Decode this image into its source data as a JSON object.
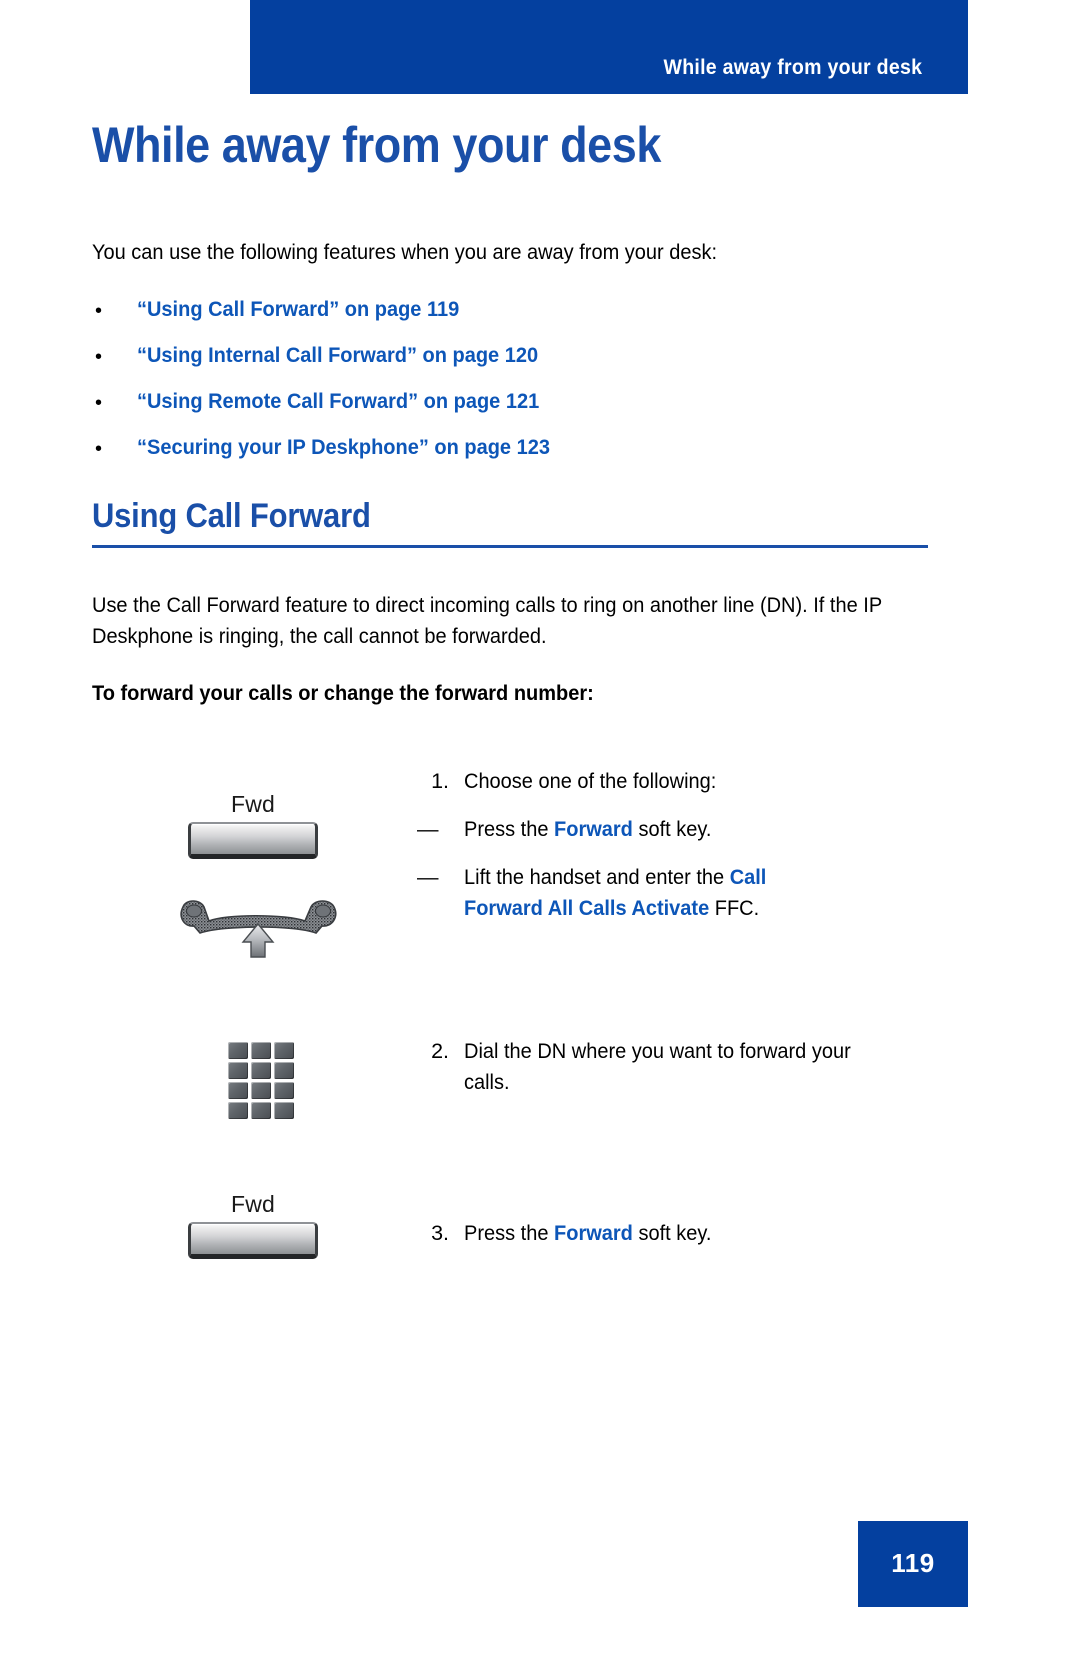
{
  "header": {
    "running_title": "While away from your desk",
    "bar_color": "#04409F"
  },
  "chapter": {
    "title": "While away from your desk",
    "title_color": "#1A4FA8"
  },
  "intro": {
    "paragraph": "You can use the following features when you are away from your desk:"
  },
  "xrefs": {
    "bullet_glyph": "•",
    "link_color": "#0D56B8",
    "items": [
      {
        "label": "“Using Call Forward” on page 119"
      },
      {
        "label": "“Using Internal Call Forward” on page 120"
      },
      {
        "label": "“Using Remote Call Forward” on page 121"
      },
      {
        "label": "“Securing your IP Deskphone” on page 123"
      }
    ]
  },
  "section": {
    "heading": "Using Call Forward",
    "rule_color": "#1A4FA8",
    "paragraph": "Use the Call Forward feature to direct incoming calls to ring on another line (DN). If the IP Deskphone is ringing, the call cannot be forwarded.",
    "procedure_lead": "To forward your calls or change the forward number:"
  },
  "procedure": {
    "steps": [
      {
        "number": "1.",
        "text": "Choose one of the following:",
        "substeps": [
          {
            "dash": "—",
            "pre": "Press the ",
            "keyword": "Forward",
            "post": " soft key."
          },
          {
            "dash": "—",
            "pre": "Lift the handset and enter the ",
            "keyword": "Call Forward All Calls Activate",
            "post": " FFC."
          }
        ],
        "art": {
          "softkey_label": "Fwd",
          "icons": [
            "softkey-fwd-icon",
            "handset-lift-icon"
          ]
        }
      },
      {
        "number": "2.",
        "text": "Dial the DN where you want to forward your calls.",
        "substeps": [],
        "art": {
          "softkey_label": "",
          "icons": [
            "dialpad-icon"
          ]
        }
      },
      {
        "number": "3.",
        "text_pre": "Press the ",
        "text_keyword": "Forward",
        "text_post": " soft key.",
        "substeps": [],
        "art": {
          "softkey_label": "Fwd",
          "icons": [
            "softkey-fwd-icon"
          ]
        }
      }
    ]
  },
  "footer": {
    "page_number": "119",
    "block_color": "#04409F"
  }
}
